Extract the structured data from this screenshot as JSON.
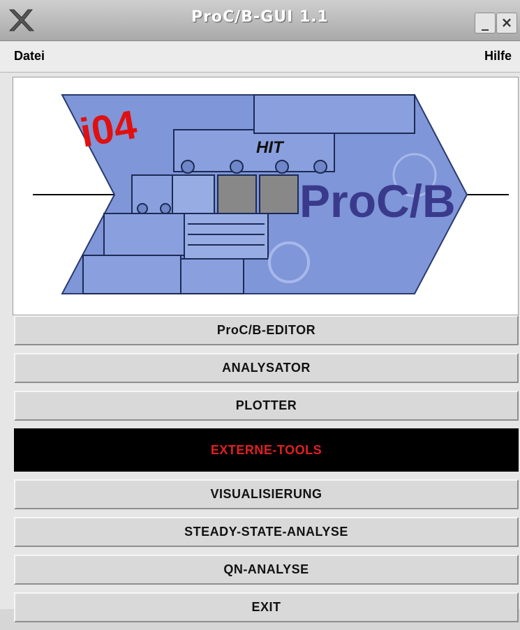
{
  "window": {
    "title": "ProC/B-GUI 1.1",
    "minimize_glyph": "_",
    "close_glyph": "×"
  },
  "menubar": {
    "left_menu": "Datei",
    "right_menu": "Hilfe"
  },
  "logo": {
    "brand_text": "ProC/B",
    "institute_text": "i04",
    "vehicle_text": "HIT"
  },
  "buttons": [
    {
      "label": "ProC/B-EDITOR",
      "active": false
    },
    {
      "label": "ANALYSATOR",
      "active": false
    },
    {
      "label": "PLOTTER",
      "active": false
    },
    {
      "label": "EXTERNE-TOOLS",
      "active": true
    },
    {
      "label": "VISUALISIERUNG",
      "active": false
    },
    {
      "label": "STEADY-STATE-ANALYSE",
      "active": false
    },
    {
      "label": "QN-ANALYSE",
      "active": false
    },
    {
      "label": "EXIT",
      "active": false
    }
  ],
  "colors": {
    "active_bg": "#000000",
    "active_text": "#e02020",
    "logo_blue": "#7f96d8",
    "brand_text": "#3a3a8c",
    "institute_red": "#e01010"
  }
}
